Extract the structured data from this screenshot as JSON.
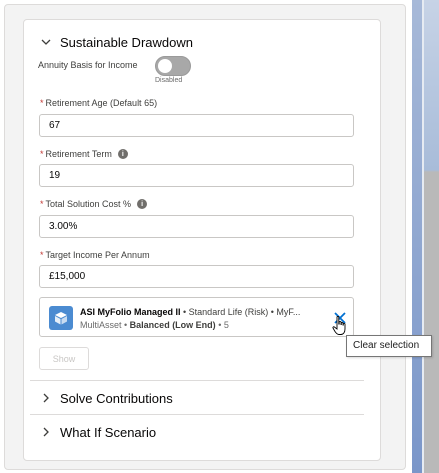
{
  "sections": {
    "drawdown_title": "Sustainable Drawdown",
    "solve_title": "Solve Contributions",
    "whatif_title": "What If Scenario"
  },
  "annuity": {
    "label": "Annuity Basis for Income",
    "state": "Disabled"
  },
  "fields": {
    "retirement_age": {
      "label": "Retirement Age (Default 65)",
      "value": "67"
    },
    "retirement_term": {
      "label": "Retirement Term",
      "value": "19"
    },
    "solution_cost": {
      "label": "Total Solution Cost %",
      "value": "3.00%"
    },
    "target_income": {
      "label": "Target Income Per Annum",
      "value": "£15,000"
    }
  },
  "required_marker": "*",
  "info_glyph": "i",
  "lookup": {
    "name": "ASI MyFolio Managed II",
    "sep": " • ",
    "detail": "Standard Life (Risk) • MyF...",
    "line2_prefix": "MultiAsset • ",
    "risk": "Balanced (Low End)",
    "line2_suffix": " • 5",
    "clear_tooltip": "Clear selection"
  },
  "show_button": "Show",
  "colors": {
    "accent": "#4b8bd1",
    "required": "#c23934",
    "toggle_off": "#a8a8a8"
  }
}
